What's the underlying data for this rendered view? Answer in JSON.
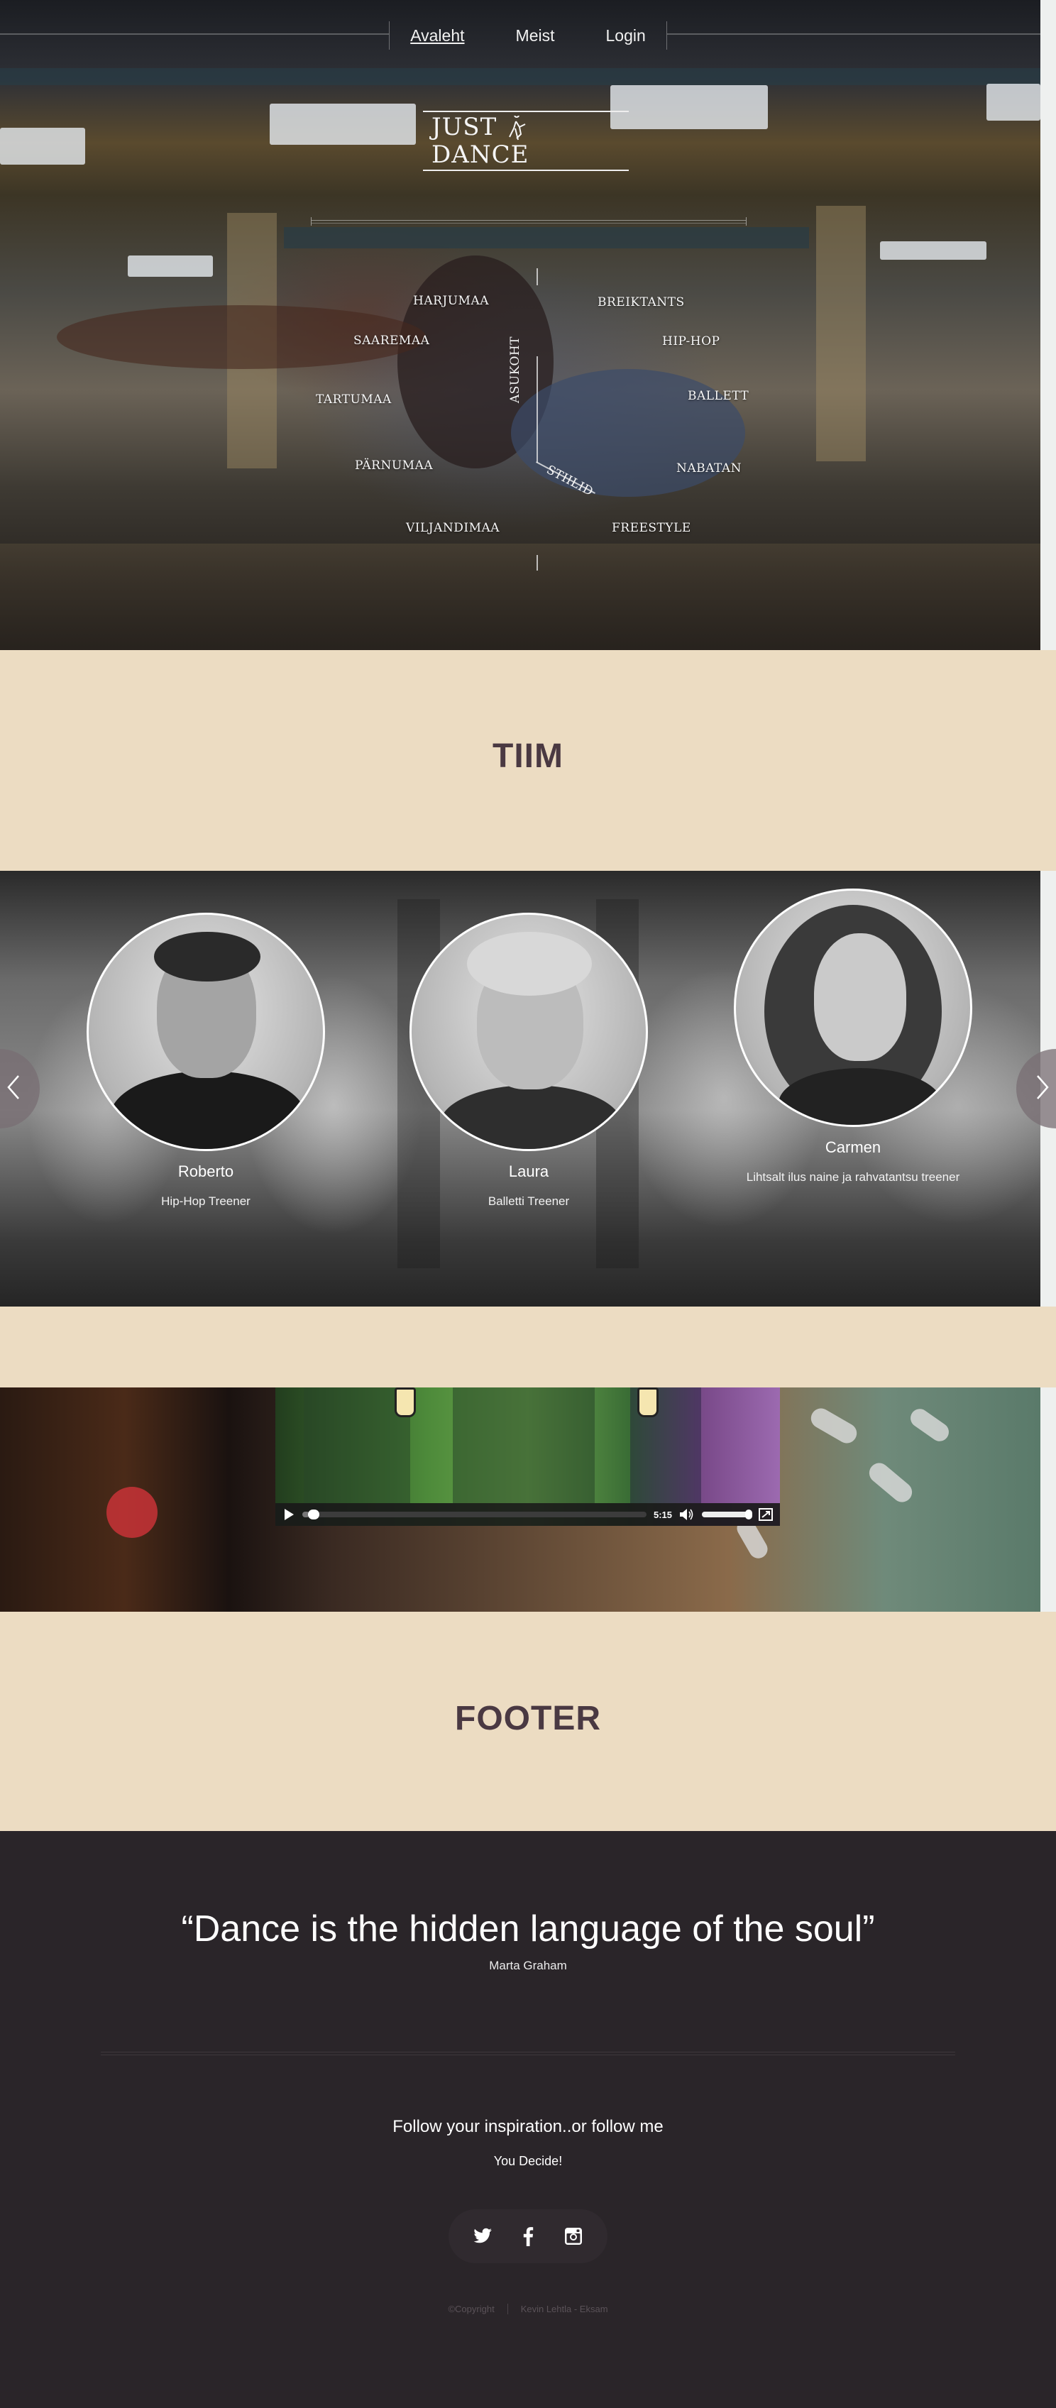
{
  "nav": {
    "items": [
      {
        "label": "Avaleht",
        "active": true
      },
      {
        "label": "Meist",
        "active": false
      },
      {
        "label": "Login",
        "active": false
      }
    ]
  },
  "logo": {
    "text_left": "JUST",
    "text_right": "DANCE"
  },
  "menu": {
    "category_location": "ASUKOHT",
    "category_styles": "STIILID",
    "regions": [
      "HARJUMAA",
      "SAAREMAA",
      "TARTUMAA",
      "PÄRNUMAA",
      "VILJANDIMAA"
    ],
    "styles": [
      "BREIKTANTS",
      "HIP-HOP",
      "BALLETT",
      "NABATAN",
      "FREESTYLE"
    ]
  },
  "team_section": {
    "title": "TIIM"
  },
  "team": [
    {
      "name": "Roberto",
      "role": "Hip-Hop Treener"
    },
    {
      "name": "Laura",
      "role": "Balletti Treener"
    },
    {
      "name": "Carmen",
      "role": "Lihtsalt ilus naine ja rahvatantsu treener"
    }
  ],
  "carousel": {
    "prev_icon": "chevron-left-icon",
    "next_icon": "chevron-right-icon"
  },
  "video": {
    "time": "5:15",
    "progress": 0.02,
    "volume": 0.95
  },
  "footer_section": {
    "title": "FOOTER"
  },
  "footer": {
    "quote": "“Dance is the hidden language of the soul”",
    "quote_author": "Marta Graham",
    "follow": "Follow your inspiration..or follow me",
    "decide": "You Decide!",
    "social": [
      "twitter-icon",
      "facebook-icon",
      "instagram-icon"
    ],
    "copyright": "©Copyright",
    "author": "Kevin Lehtla - Eksam"
  },
  "colors": {
    "beige": "#ecdcc2",
    "dark": "#2a2529",
    "title": "#4a3942"
  }
}
